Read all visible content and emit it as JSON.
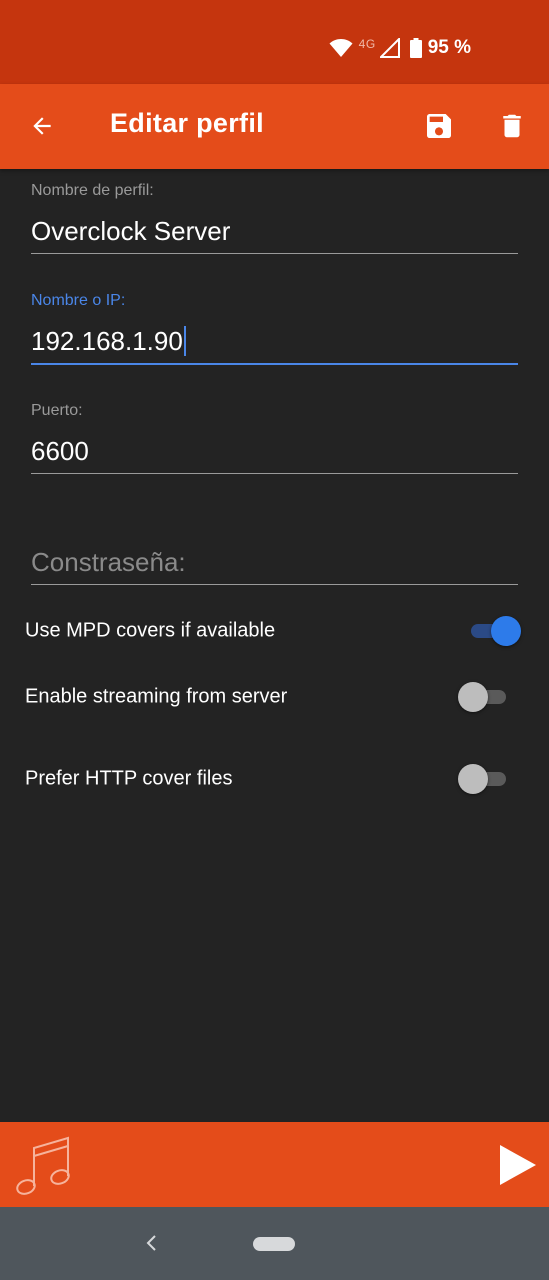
{
  "status_bar": {
    "network": "4G",
    "battery": "95 %"
  },
  "app_bar": {
    "title": "Editar perfil",
    "back_icon": "arrow-back-icon",
    "save_icon": "save-icon",
    "delete_icon": "delete-icon"
  },
  "form": {
    "profile_name": {
      "label": "Nombre de perfil:",
      "value": "Overclock Server"
    },
    "host": {
      "label": "Nombre o IP:",
      "value": "192.168.1.90"
    },
    "port": {
      "label": "Puerto:",
      "value": "6600"
    },
    "password": {
      "placeholder": "Constraseña:",
      "value": ""
    }
  },
  "toggles": [
    {
      "label": "Use MPD covers if available",
      "on": true
    },
    {
      "label": "Enable streaming from server",
      "on": false
    },
    {
      "label": "Prefer HTTP cover files",
      "on": false
    }
  ],
  "player_bar": {
    "note_icon": "music-note-icon",
    "play_icon": "play-icon"
  },
  "colors": {
    "status_bar": "#c5350e",
    "app_bar": "#e44c1a",
    "background": "#232323",
    "accent": "#4a86e8",
    "switch_on": "#2d7bea",
    "nav_bar": "#4f565c"
  }
}
